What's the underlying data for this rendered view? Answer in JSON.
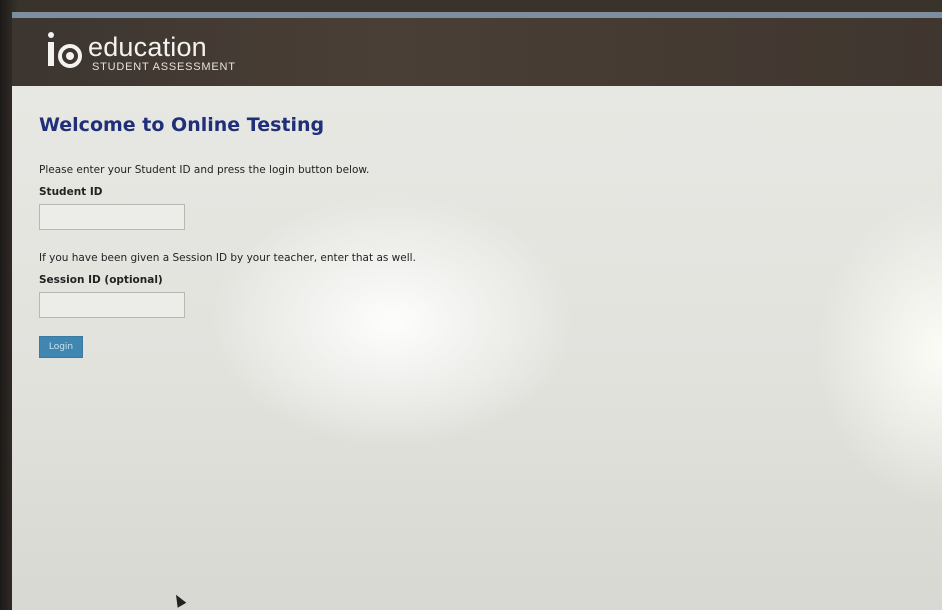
{
  "header": {
    "brand": "education",
    "subtitle": "STUDENT ASSESSMENT",
    "logo_icon": "io-logo-icon"
  },
  "main": {
    "title": "Welcome to Online Testing",
    "instruction_student": "Please enter your Student ID and press the login button below.",
    "student_id_label": "Student ID",
    "student_id_value": "",
    "instruction_session": "If you have been given a Session ID by your teacher, enter that as well.",
    "session_id_label": "Session ID (optional)",
    "session_id_value": "",
    "login_label": "Login"
  },
  "colors": {
    "header_bg": "#463c34",
    "title": "#1f2f7a",
    "button": "#3f86b0"
  }
}
